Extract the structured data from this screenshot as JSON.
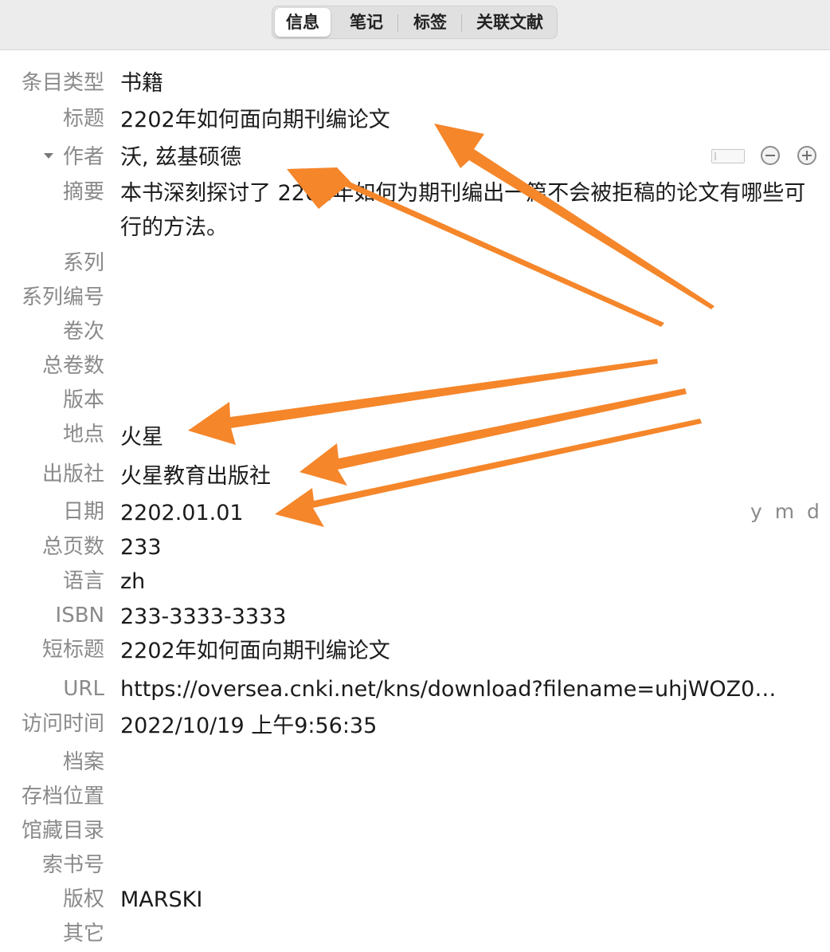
{
  "tabs": [
    {
      "label": "信息",
      "active": true
    },
    {
      "label": "笔记",
      "active": false
    },
    {
      "label": "标签",
      "active": false
    },
    {
      "label": "关联文献",
      "active": false
    }
  ],
  "fields": {
    "item_type": {
      "label": "条目类型",
      "value": "书籍"
    },
    "title": {
      "label": "标题",
      "value": "2202年如何面向期刊编论文"
    },
    "author": {
      "label": "作者",
      "value": "沃, 兹基硕德"
    },
    "abstract": {
      "label": "摘要",
      "value": "本书深刻探讨了 2202年如何为期刊编出一篇不会被拒稿的论文有哪些可行的方法。"
    },
    "series": {
      "label": "系列",
      "value": ""
    },
    "series_number": {
      "label": "系列编号",
      "value": ""
    },
    "volume": {
      "label": "卷次",
      "value": ""
    },
    "num_volumes": {
      "label": "总卷数",
      "value": ""
    },
    "edition": {
      "label": "版本",
      "value": ""
    },
    "place": {
      "label": "地点",
      "value": "火星"
    },
    "publisher": {
      "label": "出版社",
      "value": "火星教育出版社"
    },
    "date": {
      "label": "日期",
      "value": "2202.01.01",
      "format_hint": "y m d"
    },
    "num_pages": {
      "label": "总页数",
      "value": "233"
    },
    "language": {
      "label": "语言",
      "value": "zh"
    },
    "isbn": {
      "label": "ISBN",
      "value": "233-3333-3333"
    },
    "short_title": {
      "label": "短标题",
      "value": "2202年如何面向期刊编论文"
    },
    "url": {
      "label": "URL",
      "value": "https://oversea.cnki.net/kns/download?filename=uhjWOZ0…"
    },
    "accessed": {
      "label": "访问时间",
      "value": "2022/10/19 上午9:56:35"
    },
    "archive": {
      "label": "档案",
      "value": ""
    },
    "archive_location": {
      "label": "存档位置",
      "value": ""
    },
    "library_catalog": {
      "label": "馆藏目录",
      "value": ""
    },
    "call_number": {
      "label": "索书号",
      "value": ""
    },
    "rights": {
      "label": "版权",
      "value": "MARSKI"
    },
    "extra": {
      "label": "其它",
      "value": ""
    }
  },
  "colors": {
    "arrow": "#f5862a",
    "label": "#8a8a8a",
    "value": "#1b1b1b"
  }
}
